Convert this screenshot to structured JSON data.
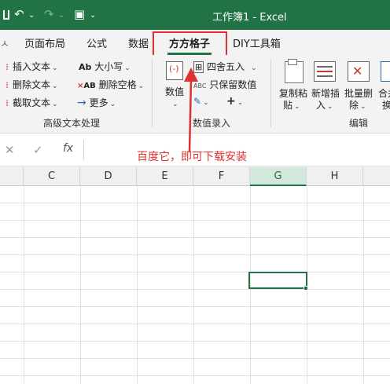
{
  "titlebar": {
    "title": "工作簿1 - Excel",
    "undo_icon": "undo-icon",
    "redo_icon": "redo-icon",
    "customize_icon": "customize-icon"
  },
  "tabs": [
    {
      "label": "页面布局"
    },
    {
      "label": "公式"
    },
    {
      "label": "数据"
    },
    {
      "label": "方方格子",
      "active": true
    },
    {
      "label": "DIY工具箱"
    }
  ],
  "ribbon": {
    "text_group": {
      "items": [
        "插入文本",
        "删除文本",
        "截取文本"
      ],
      "items2": [
        "大小写",
        "删除空格",
        "更多"
      ],
      "label": "高级文本处理"
    },
    "data_group": {
      "value_button": "数值",
      "items": [
        "四舍五入",
        "只保留数值"
      ],
      "label": "数值录入"
    },
    "edit_group": {
      "buttons": [
        {
          "line1": "复制粘",
          "line2": "贴"
        },
        {
          "line1": "新增插",
          "line2": "入"
        },
        {
          "line1": "批量删",
          "line2": "除"
        },
        {
          "line1": "合并",
          "line2": "换"
        }
      ],
      "label": "编辑"
    }
  },
  "formula_bar": {
    "fx_label": "fx",
    "annotation": "百度它，即可下载安装"
  },
  "columns": [
    {
      "label": "C"
    },
    {
      "label": "D"
    },
    {
      "label": "E"
    },
    {
      "label": "F"
    },
    {
      "label": "G",
      "selected": true
    },
    {
      "label": "H"
    }
  ],
  "colors": {
    "excel_green": "#217346",
    "highlight_red": "#e03030"
  }
}
